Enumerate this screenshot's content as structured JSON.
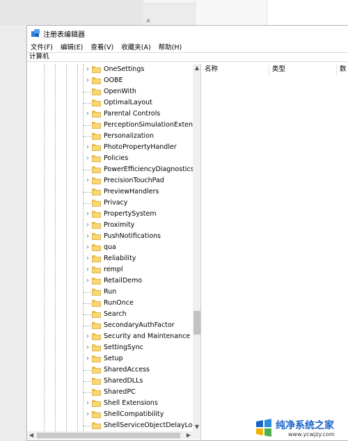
{
  "window": {
    "title": "注册表编辑器",
    "menu": [
      "文件(F)",
      "编辑(E)",
      "查看(V)",
      "收藏夹(A)",
      "帮助(H)"
    ],
    "address": "计算机"
  },
  "tree": {
    "items": [
      {
        "label": "OneSettings",
        "expandable": true
      },
      {
        "label": "OOBE",
        "expandable": true
      },
      {
        "label": "OpenWith",
        "expandable": false
      },
      {
        "label": "OptimalLayout",
        "expandable": false
      },
      {
        "label": "Parental Controls",
        "expandable": true
      },
      {
        "label": "PerceptionSimulationExtens",
        "expandable": false
      },
      {
        "label": "Personalization",
        "expandable": false
      },
      {
        "label": "PhotoPropertyHandler",
        "expandable": true
      },
      {
        "label": "Policies",
        "expandable": true,
        "active": true
      },
      {
        "label": "PowerEfficiencyDiagnostics",
        "expandable": false
      },
      {
        "label": "PrecisionTouchPad",
        "expandable": true
      },
      {
        "label": "PreviewHandlers",
        "expandable": false
      },
      {
        "label": "Privacy",
        "expandable": false
      },
      {
        "label": "PropertySystem",
        "expandable": true
      },
      {
        "label": "Proximity",
        "expandable": true
      },
      {
        "label": "PushNotifications",
        "expandable": true
      },
      {
        "label": "qua",
        "expandable": true
      },
      {
        "label": "Reliability",
        "expandable": true
      },
      {
        "label": "rempl",
        "expandable": true
      },
      {
        "label": "RetailDemo",
        "expandable": true
      },
      {
        "label": "Run",
        "expandable": false
      },
      {
        "label": "RunOnce",
        "expandable": false
      },
      {
        "label": "Search",
        "expandable": false
      },
      {
        "label": "SecondaryAuthFactor",
        "expandable": false
      },
      {
        "label": "Security and Maintenance",
        "expandable": true
      },
      {
        "label": "SettingSync",
        "expandable": true
      },
      {
        "label": "Setup",
        "expandable": true
      },
      {
        "label": "SharedAccess",
        "expandable": false
      },
      {
        "label": "SharedDLLs",
        "expandable": false
      },
      {
        "label": "SharedPC",
        "expandable": false
      },
      {
        "label": "Shell Extensions",
        "expandable": true
      },
      {
        "label": "ShellCompatibility",
        "expandable": true
      },
      {
        "label": "ShellServiceObjectDelayLoa",
        "expandable": false
      }
    ],
    "scroll_position": 0.73
  },
  "values": {
    "columns": [
      "名称",
      "类型",
      "数"
    ]
  },
  "watermark": {
    "title": "纯净系统之家",
    "url": "www.ycwjzy.com"
  },
  "icons": {
    "expander": "chevron-right-icon",
    "folder": "folder-icon",
    "app": "regedit-icon",
    "scroll_up": "scroll-up-icon",
    "scroll_down": "scroll-down-icon",
    "scroll_left": "scroll-left-icon",
    "scroll_right": "scroll-right-icon"
  },
  "colors": {
    "folder": "#f8d775",
    "active_expander": "#3a8ee6",
    "watermark": "#1a64c8"
  }
}
